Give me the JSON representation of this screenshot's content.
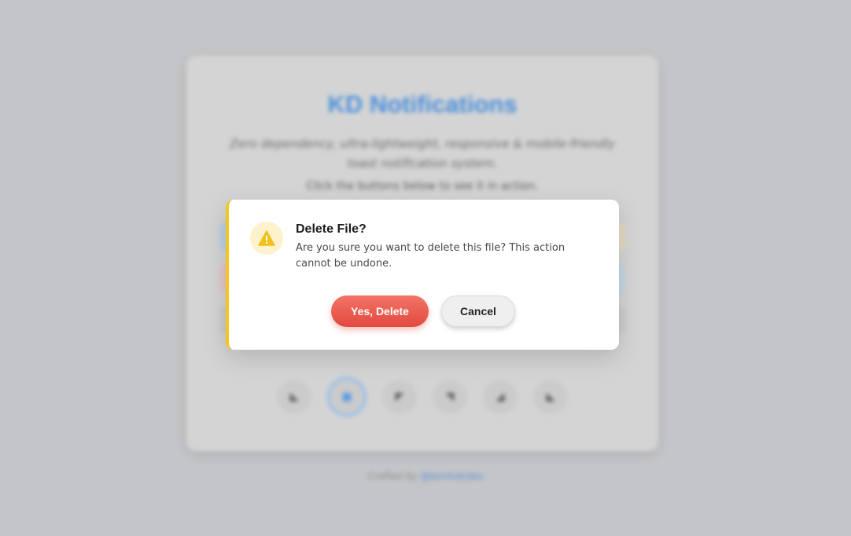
{
  "background": {
    "title": "KD Notifications",
    "description": "Zero dependency, ultra-lightweight, responsive & mobile-friendly toast notification system.",
    "subtitle": "Click the buttons below to see it in action.",
    "credit_prefix": "Crafted by",
    "credit_link": "@kenitokides"
  },
  "dialog": {
    "icon": "warning-triangle-icon",
    "accent_color": "#f3c623",
    "title": "Delete File?",
    "message": "Are you sure you want to delete this file? This action cannot be undone.",
    "confirm_label": "Yes, Delete",
    "cancel_label": "Cancel"
  },
  "colors": {
    "confirm": "#e84f43",
    "title_blue": "#4c8fda"
  }
}
